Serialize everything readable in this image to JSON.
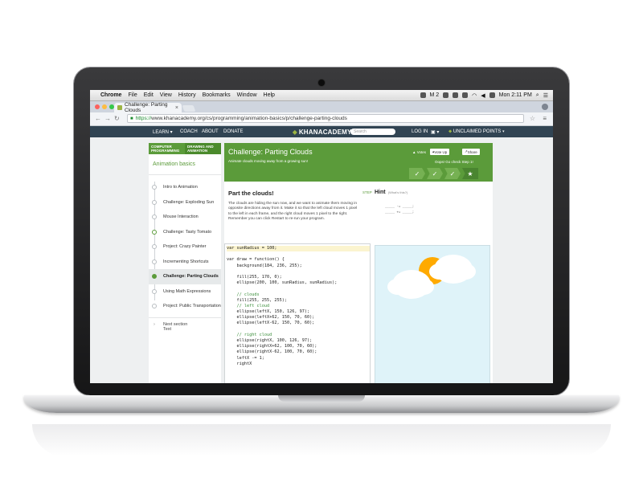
{
  "menubar": {
    "items": [
      "Chrome",
      "File",
      "Edit",
      "View",
      "History",
      "Bookmarks",
      "Window",
      "Help"
    ],
    "status_m": "M 2",
    "clock": "Mon 2:11 PM"
  },
  "browser": {
    "tab_title": "Challenge: Parting Clouds",
    "url_scheme": "https://",
    "url_rest": "www.khanacademy.org/cs/programming/animation-basics/p/challenge-parting-clouds"
  },
  "khan_nav": {
    "learn": "LEARN ▾",
    "coach": "COACH",
    "about": "ABOUT",
    "donate": "DONATE",
    "logo": "KHANACADEMY",
    "search_placeholder": "Search",
    "login": "LOG IN",
    "unclaimed": "UNCLAIMED POINTS ▾"
  },
  "sidebar": {
    "crumb1": "COMPUTER PROGRAMMING",
    "crumb2": "DRAWING AND ANIMATION",
    "title": "Animation basics",
    "items": [
      "Intro to Animation",
      "Challenge: Exploding Sun",
      "Mouse Interaction",
      "Challenge: Tasty Tomato",
      "Project: Crazy Painter",
      "Incrementing Shortcuts",
      "Challenge: Parting Clouds",
      "Using Math Expressions",
      "Project: Public Transportation"
    ],
    "next_label": "Next section",
    "next_title": "Text"
  },
  "banner": {
    "title": "Challenge: Parting Clouds",
    "subtitle": "Animate clouds moving away from a growing sun!",
    "votes": "Votes",
    "vote_up": "Vote Up",
    "share": "Share",
    "oops": "Oops! Go check Step 1!"
  },
  "instructions": {
    "heading": "Part the clouds!",
    "body": "The clouds are hiding the sun now, and we want to animate them moving in opposite directions away from it. Make it so that the left cloud moves 1 pixel to the left in each frame, and the right cloud moves 1 pixel to the right. Remember you can click Restart to re-run your program.",
    "step": "STEP",
    "hint": "Hint",
    "whats_this": "(What's this?)",
    "hint_line1": "_____ -= _____;",
    "hint_line2": "_____ += _____;"
  },
  "code_lines": [
    "var sunRadius = 100;",
    "",
    "var draw = function() {",
    "    background(184, 236, 255);",
    "",
    "    fill(255, 170, 0);",
    "    ellipse(200, 100, sunRadius, sunRadius);",
    "",
    "    // clouds",
    "    fill(255, 255, 255);",
    "    // left cloud",
    "    ellipse(leftX, 150, 126, 97);",
    "    ellipse(leftX+62, 150, 70, 60);",
    "    ellipse(leftX-62, 150, 70, 60);",
    "",
    "    // right cloud",
    "    ellipse(rightX, 100, 126, 97);",
    "    ellipse(rightX+62, 100, 70, 60);",
    "    ellipse(rightX-62, 100, 70, 60);",
    "    leftX -= 1;",
    "    rightX"
  ],
  "colors": {
    "khan_green": "#5b9b3a",
    "nav_dark": "#314453",
    "sky": "#dff3f9",
    "sun": "#ffaa00"
  },
  "dock_icons": [
    "finder-icon",
    "launchpad-icon",
    "mission-control-icon",
    "stickies-icon",
    "photos-icon",
    "chrome-icon",
    "safari-icon",
    "messages-icon",
    "facetime-icon",
    "mail-icon",
    "terminal-icon",
    "activity-icon",
    "calendar-icon",
    "system-prefs-icon",
    "app-store-icon",
    "maps-icon",
    "preview-icon",
    "itunes-icon",
    "firefox-icon",
    "photoshop-icon",
    "pref-icon",
    "image-capture-icon",
    "folder-icon",
    "trash-icon"
  ]
}
